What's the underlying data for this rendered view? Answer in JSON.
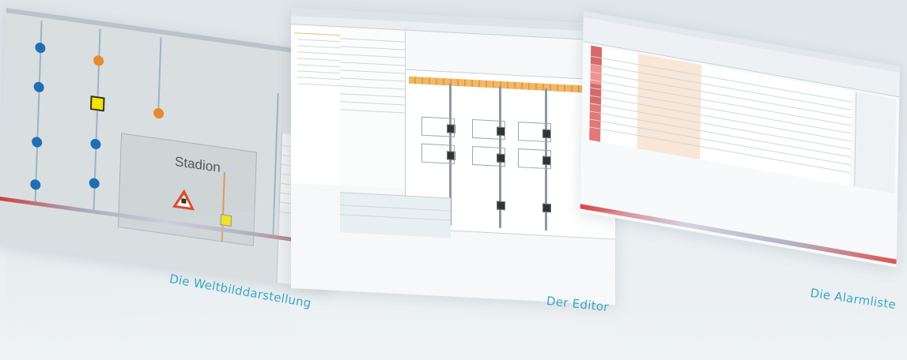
{
  "panels": {
    "world": {
      "caption": "Die Weltbilddarstellung",
      "stadium_label": "Stadion"
    },
    "editor": {
      "caption": "Der Editor"
    },
    "alarm": {
      "caption": "Die Alarmliste"
    }
  },
  "colors": {
    "accent": "#3aa6c8",
    "blue_marker": "#1f6fb3",
    "orange_marker": "#e8892e",
    "yellow_marker": "#f2e400",
    "warning_red": "#e04a2a",
    "editor_orange": "#f0b86a"
  },
  "icons": [
    "warning-triangle-icon",
    "blue-circle-marker-icon",
    "orange-circle-marker-icon"
  ]
}
